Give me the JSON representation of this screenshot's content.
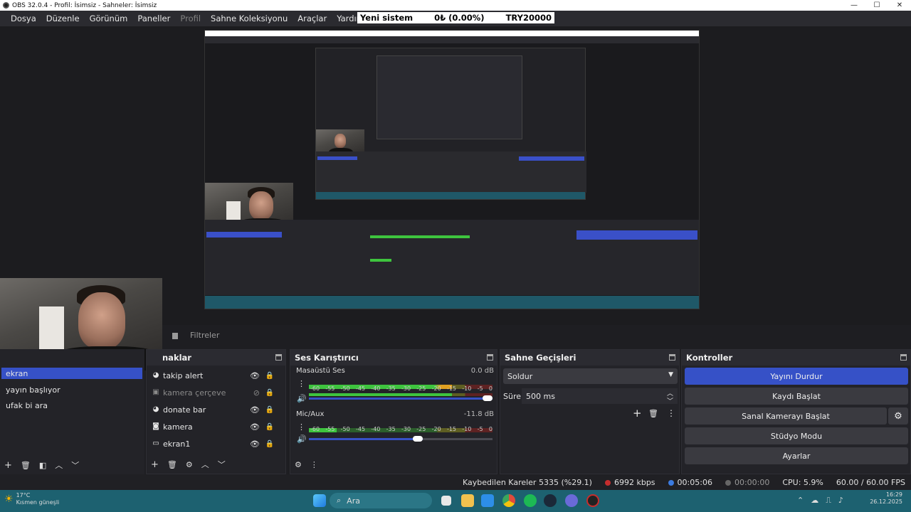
{
  "window": {
    "title": "OBS 32.0.4 - Profil: İsimsiz - Sahneler: İsimsiz",
    "controls": [
      "—",
      "☐",
      "✕"
    ]
  },
  "menu": [
    {
      "label": "Dosya"
    },
    {
      "label": "Düzenle"
    },
    {
      "label": "Görünüm"
    },
    {
      "label": "Paneller"
    },
    {
      "label": "Profil",
      "disabled": true
    },
    {
      "label": "Sahne Koleksiyonu"
    },
    {
      "label": "Araçlar"
    },
    {
      "label": "Yardım"
    }
  ],
  "ticker": {
    "left": "Yeni sistem",
    "middle": "0₺ (0.00%)",
    "right": "TRY20000"
  },
  "filters_label": "Filtreler",
  "scenes": {
    "title": "",
    "items": [
      "ekran",
      "yayın başlıyor",
      "ufak bi ara"
    ],
    "selected_index": 0
  },
  "sources": {
    "title": "naklar",
    "items": [
      {
        "name": "takip alert",
        "icon": "browser-icon",
        "visible": true
      },
      {
        "name": "kamera çerçeve",
        "icon": "image-icon",
        "visible": false
      },
      {
        "name": "donate bar",
        "icon": "browser-icon",
        "visible": true
      },
      {
        "name": "kamera",
        "icon": "camera-icon",
        "visible": true
      },
      {
        "name": "ekran1",
        "icon": "monitor-icon",
        "visible": true
      }
    ]
  },
  "mixer": {
    "title": "Ses Karıştırıcı",
    "ticks": [
      "-60",
      "-55",
      "-50",
      "-45",
      "-40",
      "-35",
      "-30",
      "-25",
      "-20",
      "-15",
      "-10",
      "-5",
      "0"
    ],
    "channels": [
      {
        "name": "Masaüstü Ses",
        "db": "0.0 dB",
        "level": 0.78,
        "volume": 1.0
      },
      {
        "name": "Mic/Aux",
        "db": "-11.8 dB",
        "level": 0.15,
        "volume": 0.62
      }
    ]
  },
  "transitions": {
    "title": "Sahne Geçişleri",
    "selected": "Soldur",
    "duration_label": "Süre",
    "duration_value": "500 ms"
  },
  "controls": {
    "title": "Kontroller",
    "buttons": [
      "Yayını Durdur",
      "Kaydı Başlat",
      "Sanal Kamerayı Başlat",
      "Stüdyo Modu",
      "Ayarlar"
    ]
  },
  "status": {
    "dropped": "Kaybedilen Kareler 5335 (%29.1)",
    "bitrate": "6992 kbps",
    "stream_time": "00:05:06",
    "rec_time": "00:00:00",
    "cpu": "CPU: 5.9%",
    "fps": "60.00 / 60.00 FPS"
  },
  "taskbar": {
    "search_placeholder": "Ara",
    "weather_temp": "17°C",
    "weather_desc": "Kısmen güneşli",
    "time": "16:29",
    "date": "26.12.2025"
  },
  "colors": {
    "accent": "#3651c7",
    "green": "#3ec43e",
    "yellow": "#c8c829",
    "red": "#c62d2d",
    "taskbar": "#1d6170"
  }
}
